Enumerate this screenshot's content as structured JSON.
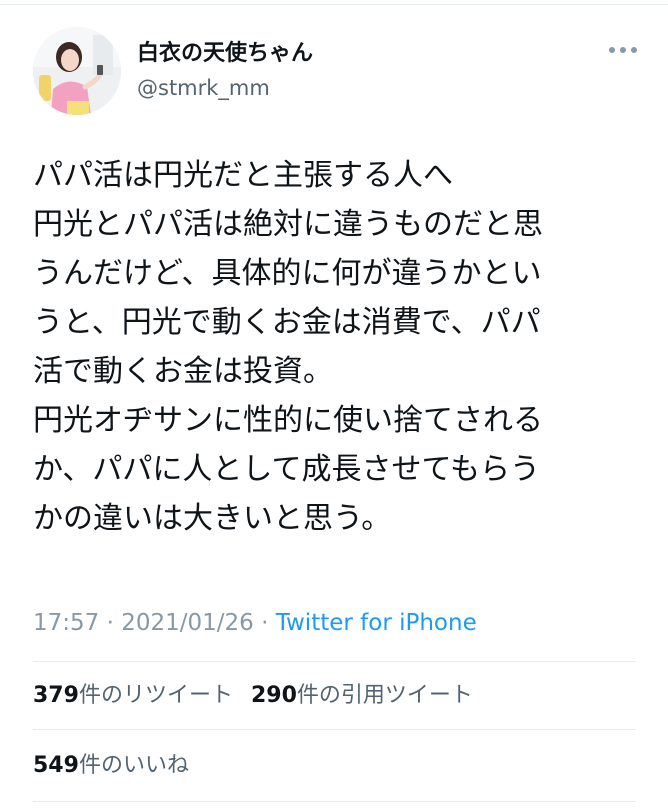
{
  "user": {
    "display_name": "白衣の天使ちゃん",
    "handle": "@stmrk_mm"
  },
  "icons": {
    "avatar": "profile-photo",
    "more": "more-dots-icon"
  },
  "tweet": {
    "lines": [
      "パパ活は円光だと主張する人へ",
      "円光とパパ活は絶対に違うものだと思",
      "うんだけど、具体的に何が違うかとい",
      "うと、円光で動くお金は消費で、パパ",
      "活で動くお金は投資。",
      "円光オヂサンに性的に使い捨てされる",
      "か、パパに人として成長させてもらう",
      "かの違いは大きいと思う。"
    ]
  },
  "meta": {
    "time": "17:57",
    "sep1": " · ",
    "date": "2021/01/26",
    "sep2": " · ",
    "source": "Twitter for iPhone"
  },
  "stats": {
    "retweets_count": "379",
    "retweets_label": "件のリツイート",
    "quotes_count": "290",
    "quotes_label": "件の引用ツイート",
    "likes_count": "549",
    "likes_label": "件のいいね"
  },
  "colors": {
    "text": "#0f1419",
    "secondary": "#536471",
    "muted": "#8899a6",
    "link": "#1d9bf0",
    "divider": "#e6ecf0"
  }
}
